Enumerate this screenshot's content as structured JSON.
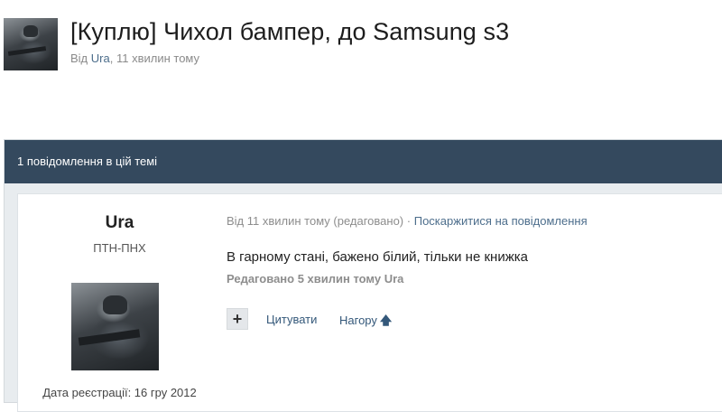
{
  "topic": {
    "title": "[Куплю] Чихол бампер, до Samsung s3",
    "meta_prefix": "Від",
    "author": "Ura",
    "meta_sep": ",",
    "time": "11 хвилин тому"
  },
  "thread": {
    "header": "1 повідомлення в цій темі"
  },
  "post": {
    "author_name": "Ura",
    "author_group": "ПТН-ПНХ",
    "join_date": "Дата реєстрації: 16 гру 2012",
    "meta_time": "Від 11 хвилин тому (редаговано)",
    "meta_sep": "·",
    "report_link": "Поскаржитися на повідомлення",
    "body": "В гарному стані, бажено білий, тільки не книжка",
    "edited": "Редаговано 5 хвилин тому Ura",
    "plus_label": "+",
    "quote_label": "Цитувати",
    "top_label": "Нагору",
    "top_arrow": "🡅"
  },
  "icons": {
    "plus": "plus-icon",
    "arrow_up": "arrow-up-icon"
  },
  "colors": {
    "header_bg": "#34495e",
    "link": "#34587a"
  }
}
